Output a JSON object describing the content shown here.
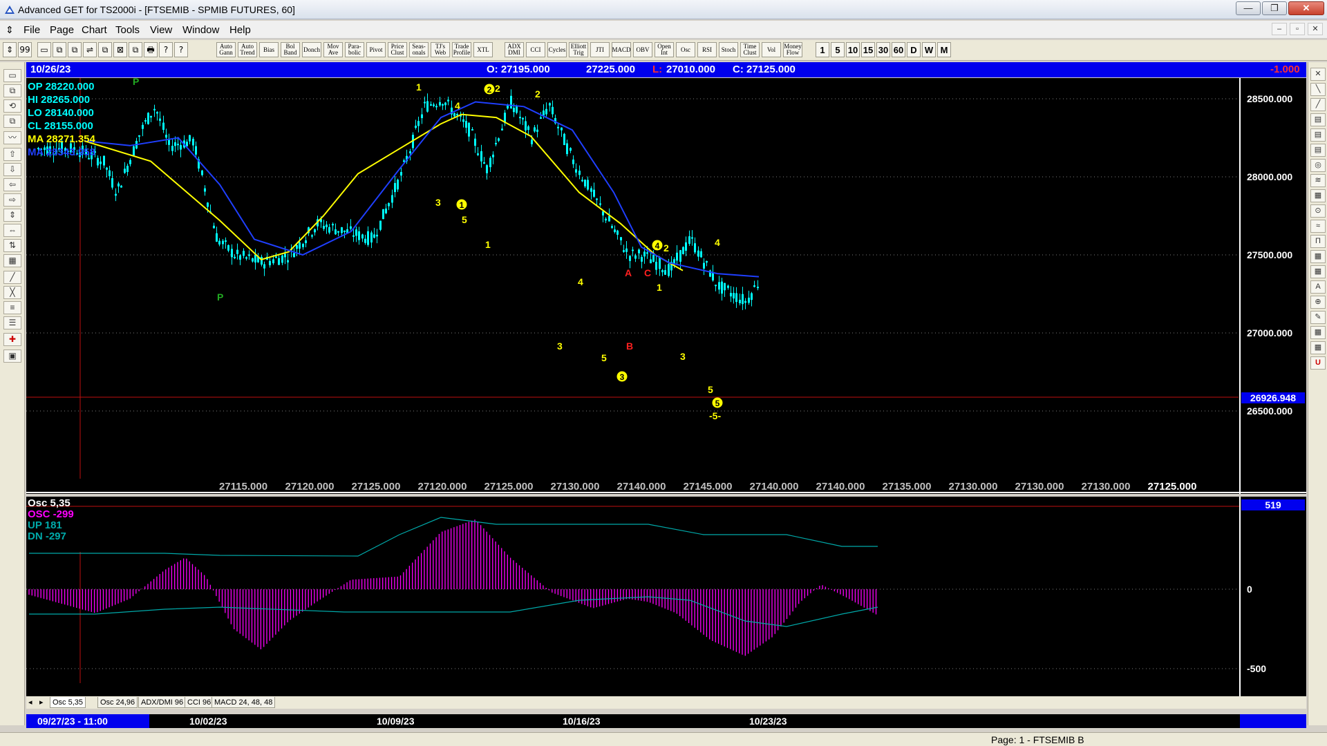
{
  "window": {
    "title": "Advanced GET for TS2000i - [FTSEMIB - SPMIB FUTURES, 60]",
    "min": "—",
    "max": "❐",
    "close": "✕"
  },
  "menu": {
    "items": [
      "File",
      "Page",
      "Chart",
      "Tools",
      "View",
      "Window",
      "Help"
    ],
    "mdi": [
      "–",
      "▫",
      "✕"
    ]
  },
  "toolbar": {
    "icons_left": [
      "⇕",
      "99",
      "▭",
      "⧉",
      "⧉",
      "⇌",
      "⧉",
      "⊠",
      "⧉",
      "🖶",
      "?",
      "?"
    ],
    "studies": [
      "Auto Gann",
      "Auto Trend",
      "Bias",
      "Bol Band",
      "Donch",
      "Mov Ave",
      "Para- bolic",
      "Pivot",
      "Price Clust",
      "Seas- onals",
      "TJ's Web",
      "Trade Profile",
      "XTL",
      "ADX DMI",
      "CCI",
      "Cycles",
      "Elliott Trig",
      "JTI",
      "MACD",
      "OBV",
      "Open Int",
      "Osc",
      "RSI",
      "Stoch",
      "Time Clust",
      "Vol",
      "Money Flow"
    ],
    "timeframes": [
      "1",
      "5",
      "10",
      "15",
      "30",
      "60",
      "D",
      "W",
      "M"
    ]
  },
  "header": {
    "date": "10/26/23",
    "open": "O: 27195.000",
    "high": "27225.000",
    "low_label": "L:",
    "low": "27010.000",
    "close": "C: 27125.000",
    "change": "-1.000"
  },
  "price_legend": [
    {
      "label": "OP  28220.000",
      "color": "#00ffff"
    },
    {
      "label": "HI   28265.000",
      "color": "#00ffff"
    },
    {
      "label": "LO  28140.000",
      "color": "#00ffff"
    },
    {
      "label": "CL  28155.000",
      "color": "#00ffff"
    },
    {
      "label": "MA  28271.354",
      "color": "#ffff00"
    },
    {
      "label": "MA  28343.958",
      "color": "#2040ff"
    }
  ],
  "price_axis": {
    "ticks": [
      "28500.000",
      "28000.000",
      "27500.000",
      "27000.000",
      "26500.000"
    ],
    "current": "26926.948"
  },
  "bottom_values": [
    "27115.000",
    "27120.000",
    "27125.000",
    "27120.000",
    "27125.000",
    "27130.000",
    "27140.000",
    "27145.000",
    "27140.000",
    "27140.000",
    "27135.000",
    "27130.000",
    "27130.000",
    "27130.000",
    "27125.000"
  ],
  "wave_labels": [
    {
      "t": "P",
      "c": "#22aa22"
    },
    {
      "t": "P",
      "c": "#22aa22"
    },
    {
      "t": "1",
      "c": "#ffff00"
    },
    {
      "t": "2",
      "c": "#ffff00"
    },
    {
      "t": "2",
      "c": "#ffff00"
    },
    {
      "t": "4",
      "c": "#ffff00"
    },
    {
      "t": "3",
      "c": "#ffff00"
    },
    {
      "t": "5",
      "c": "#ffff00"
    },
    {
      "t": "1",
      "c": "#ffff00"
    },
    {
      "t": "4",
      "c": "#ffff00"
    },
    {
      "t": "3",
      "c": "#ffff00"
    },
    {
      "t": "5",
      "c": "#ffff00"
    },
    {
      "t": "A",
      "c": "#ff2020"
    },
    {
      "t": "B",
      "c": "#ff2020"
    },
    {
      "t": "C",
      "c": "#ff2020"
    },
    {
      "t": "2",
      "c": "#ffff00"
    },
    {
      "t": "1",
      "c": "#ffff00"
    },
    {
      "t": "4",
      "c": "#ffff00"
    },
    {
      "t": "3",
      "c": "#ffff00"
    },
    {
      "t": "5",
      "c": "#ffff00"
    },
    {
      "t": "-5-",
      "c": "#ffff00"
    }
  ],
  "circled_labels": [
    "2",
    "1",
    "3",
    "4",
    "5"
  ],
  "osc_legend": [
    {
      "label": "Osc 5,35",
      "color": "#ffffff"
    },
    {
      "label": "OSC -299",
      "color": "#ff00ff"
    },
    {
      "label": "UP   181",
      "color": "#00aaaa"
    },
    {
      "label": "DN   -297",
      "color": "#00aaaa"
    }
  ],
  "osc_axis": {
    "ticks": [
      "0",
      "-500"
    ],
    "current": "519"
  },
  "tabs": [
    "Osc 5,35",
    "Osc 24,96",
    "ADX/DMI 96",
    "CCI 96",
    "MACD 24, 48, 48"
  ],
  "dates": [
    "09/27/23 - 11:00",
    "10/02/23",
    "10/09/23",
    "10/16/23",
    "10/23/23"
  ],
  "status": "Page: 1 - FTSEMIB B",
  "colors": {
    "candle": "#00ffff",
    "ma_fast": "#ffff00",
    "ma_slow": "#1f3fff",
    "osc": "#ff00ff",
    "band": "#00aaaa",
    "header_bg": "#0000ee"
  },
  "chart_data": {
    "type": "line",
    "series": [],
    "ylim": [
      26500,
      28600
    ]
  }
}
